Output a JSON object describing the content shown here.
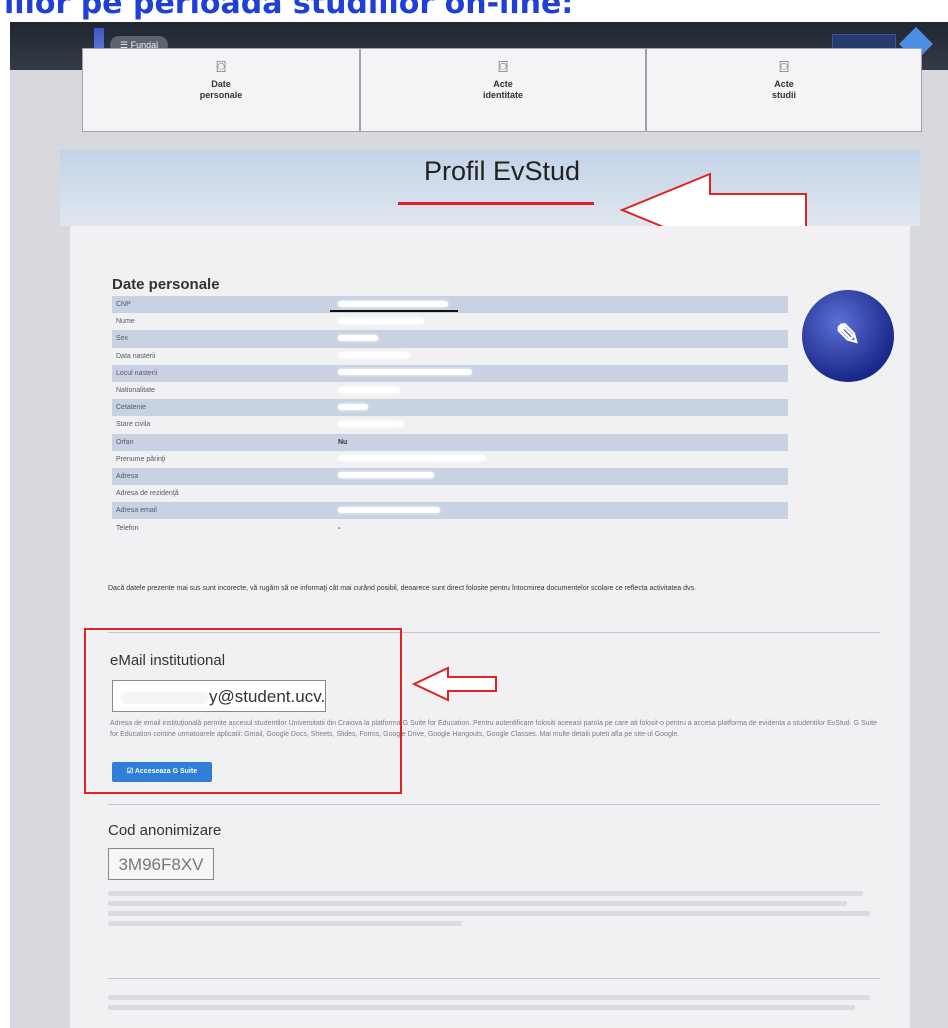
{
  "caption": "iilor pe perioada studiilor on-line:",
  "topbar": {
    "menu_label": "☰ Fundal"
  },
  "nav_cards": [
    {
      "label": "Date\npersonale"
    },
    {
      "label": "Acte\nidentitate"
    },
    {
      "label": "Acte\nstudii"
    }
  ],
  "header": {
    "title": "Profil EvStud"
  },
  "personal": {
    "title": "Date personale",
    "rows": [
      {
        "key": "CNP",
        "value": ""
      },
      {
        "key": "Nume",
        "value": ""
      },
      {
        "key": "Sex",
        "value": ""
      },
      {
        "key": "Data nasterii",
        "value": ""
      },
      {
        "key": "Locul nasterii",
        "value": ""
      },
      {
        "key": "Nationalitate",
        "value": ""
      },
      {
        "key": "Cetatenie",
        "value": ""
      },
      {
        "key": "Stare civila",
        "value": ""
      },
      {
        "key": "Orfan",
        "value": "Nu"
      },
      {
        "key": "Prenume părinţi",
        "value": ""
      },
      {
        "key": "Adresa",
        "value": ""
      },
      {
        "key": "Adresa de rezidenţă",
        "value": ""
      },
      {
        "key": "Adresa email",
        "value": ""
      },
      {
        "key": "Telefon",
        "value": "-"
      }
    ],
    "notice": "Dacă datele prezente mai sus sunt incorecte, vă rugăm să ne informaţi cât mai curând posibil, deoarece sunt direct folosite pentru întocmirea documentelor scolare ce reflecta activitatea dvs."
  },
  "email": {
    "title": "eMail institutional",
    "value_suffix": "y@student.ucv.ro",
    "description": "Adresa de email instituţională permite accesul studentilor Universitatii din Craiova la platforma G Suite for Education. Pentru autentificare folositi aceeasi parola pe care ati folosit-o pentru a accesa platforma de evidenta a studentilor EvStud. G Suite for Education contine urmatoarele aplicatii: Gmail, Google Docs, Sheets, Slides, Forms, Google Drive, Google Hangouts, Google Classes. Mai multe detalii puteti afla pe site-ul Google.",
    "button_label": "☑ Acceseaza G Suite"
  },
  "cod": {
    "title": "Cod anonimizare",
    "value": "3M96F8XV"
  },
  "colors": {
    "accent": "#2f7ed8",
    "annotation": "#e02424",
    "caption": "#1f3fd6"
  }
}
